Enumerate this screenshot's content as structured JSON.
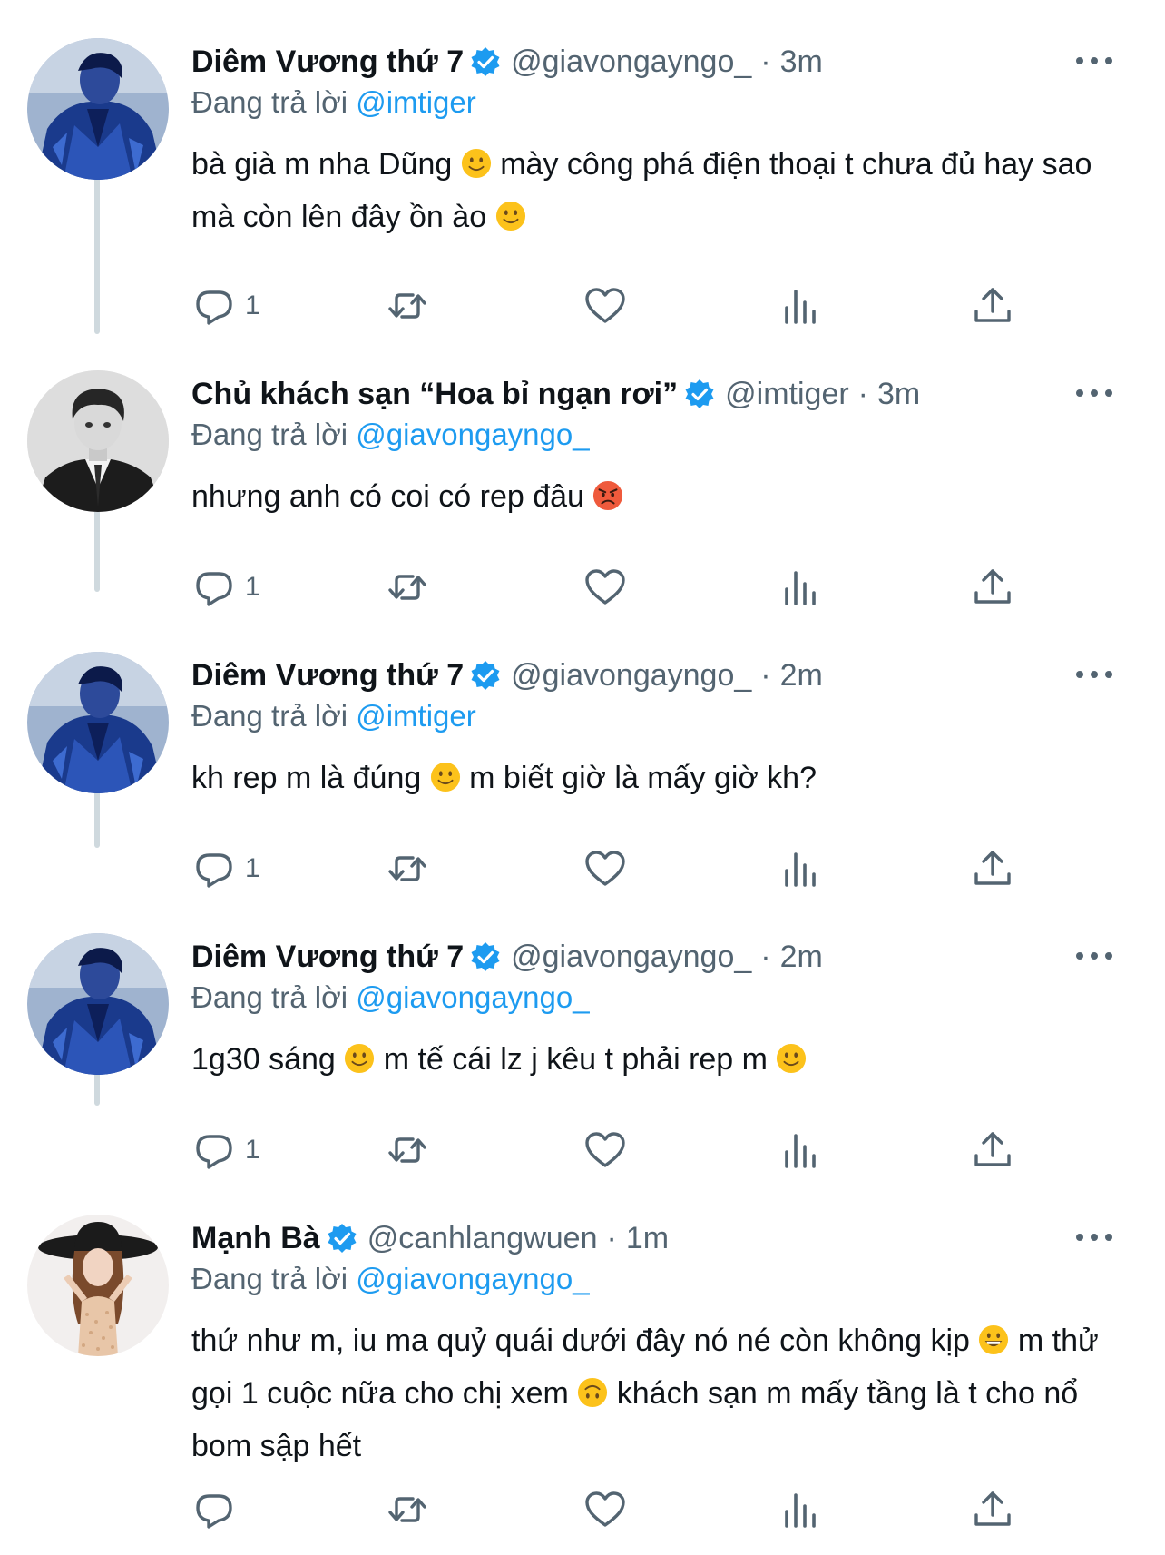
{
  "tweets": [
    {
      "name": "Diêm Vương thứ 7",
      "handle": "@giavongayngo_",
      "dot": "·",
      "time": "3m",
      "replying_label": "Đang trả lời",
      "replying_to": "@imtiger",
      "body": [
        {
          "text": "bà già m nha Dũng "
        },
        {
          "emoji": "slightly-smiling-face"
        },
        {
          "text": " mày công phá điện thoại t chưa đủ hay sao mà còn lên đây ồn ào "
        },
        {
          "emoji": "slightly-smiling-face"
        }
      ],
      "avatar": "man-blue-jacket",
      "reply_count": "1"
    },
    {
      "name": "Chủ khách sạn “Hoa bỉ ngạn rơi”",
      "handle": "@imtiger",
      "dot": "·",
      "time": "3m",
      "replying_label": "Đang trả lời",
      "replying_to": "@giavongayngo_",
      "body": [
        {
          "text": "nhưng anh có coi có rep đâu "
        },
        {
          "emoji": "angry-face"
        }
      ],
      "avatar": "man-black-suit-bw",
      "reply_count": "1"
    },
    {
      "name": "Diêm Vương thứ 7",
      "handle": "@giavongayngo_",
      "dot": "·",
      "time": "2m",
      "replying_label": "Đang trả lời",
      "replying_to": "@imtiger",
      "body": [
        {
          "text": "kh rep m là đúng "
        },
        {
          "emoji": "slightly-smiling-face"
        },
        {
          "text": " m biết giờ là mấy giờ kh?"
        }
      ],
      "avatar": "man-blue-jacket",
      "reply_count": "1"
    },
    {
      "name": "Diêm Vương thứ 7",
      "handle": "@giavongayngo_",
      "dot": "·",
      "time": "2m",
      "replying_label": "Đang trả lời",
      "replying_to": "@giavongayngo_",
      "body": [
        {
          "text": "1g30 sáng "
        },
        {
          "emoji": "slightly-smiling-face"
        },
        {
          "text": " m tế cái lz j kêu t phải rep m "
        },
        {
          "emoji": "slightly-smiling-face"
        }
      ],
      "avatar": "man-blue-jacket",
      "reply_count": "1"
    },
    {
      "name": "Mạnh Bà",
      "handle": "@canhlangwuen",
      "dot": "·",
      "time": "1m",
      "replying_label": "Đang trả lời",
      "replying_to": "@giavongayngo_",
      "body": [
        {
          "text": "thứ như m, iu ma quỷ quái dưới đây nó né còn không kịp "
        },
        {
          "emoji": "grinning-face"
        },
        {
          "text": " m thử gọi 1 cuộc nữa cho chị xem "
        },
        {
          "emoji": "upside-down-face"
        },
        {
          "text": " khách sạn m mấy tầng là t cho nổ bom sập hết"
        }
      ],
      "avatar": "woman-black-hat",
      "reply_count": ""
    }
  ],
  "icons": {
    "verified": "verified-badge-icon",
    "more": "more-options-icon",
    "reply": "reply-icon",
    "retweet": "retweet-icon",
    "like": "like-icon",
    "analytics": "analytics-icon",
    "share": "share-icon"
  },
  "colors": {
    "accent": "#1d9bf0",
    "secondary_text": "#536471",
    "primary_text": "#0f1419",
    "thread_line": "#cfd9de",
    "emoji_yellow": "#fcc21b",
    "angry_red": "#ef5a3c"
  }
}
